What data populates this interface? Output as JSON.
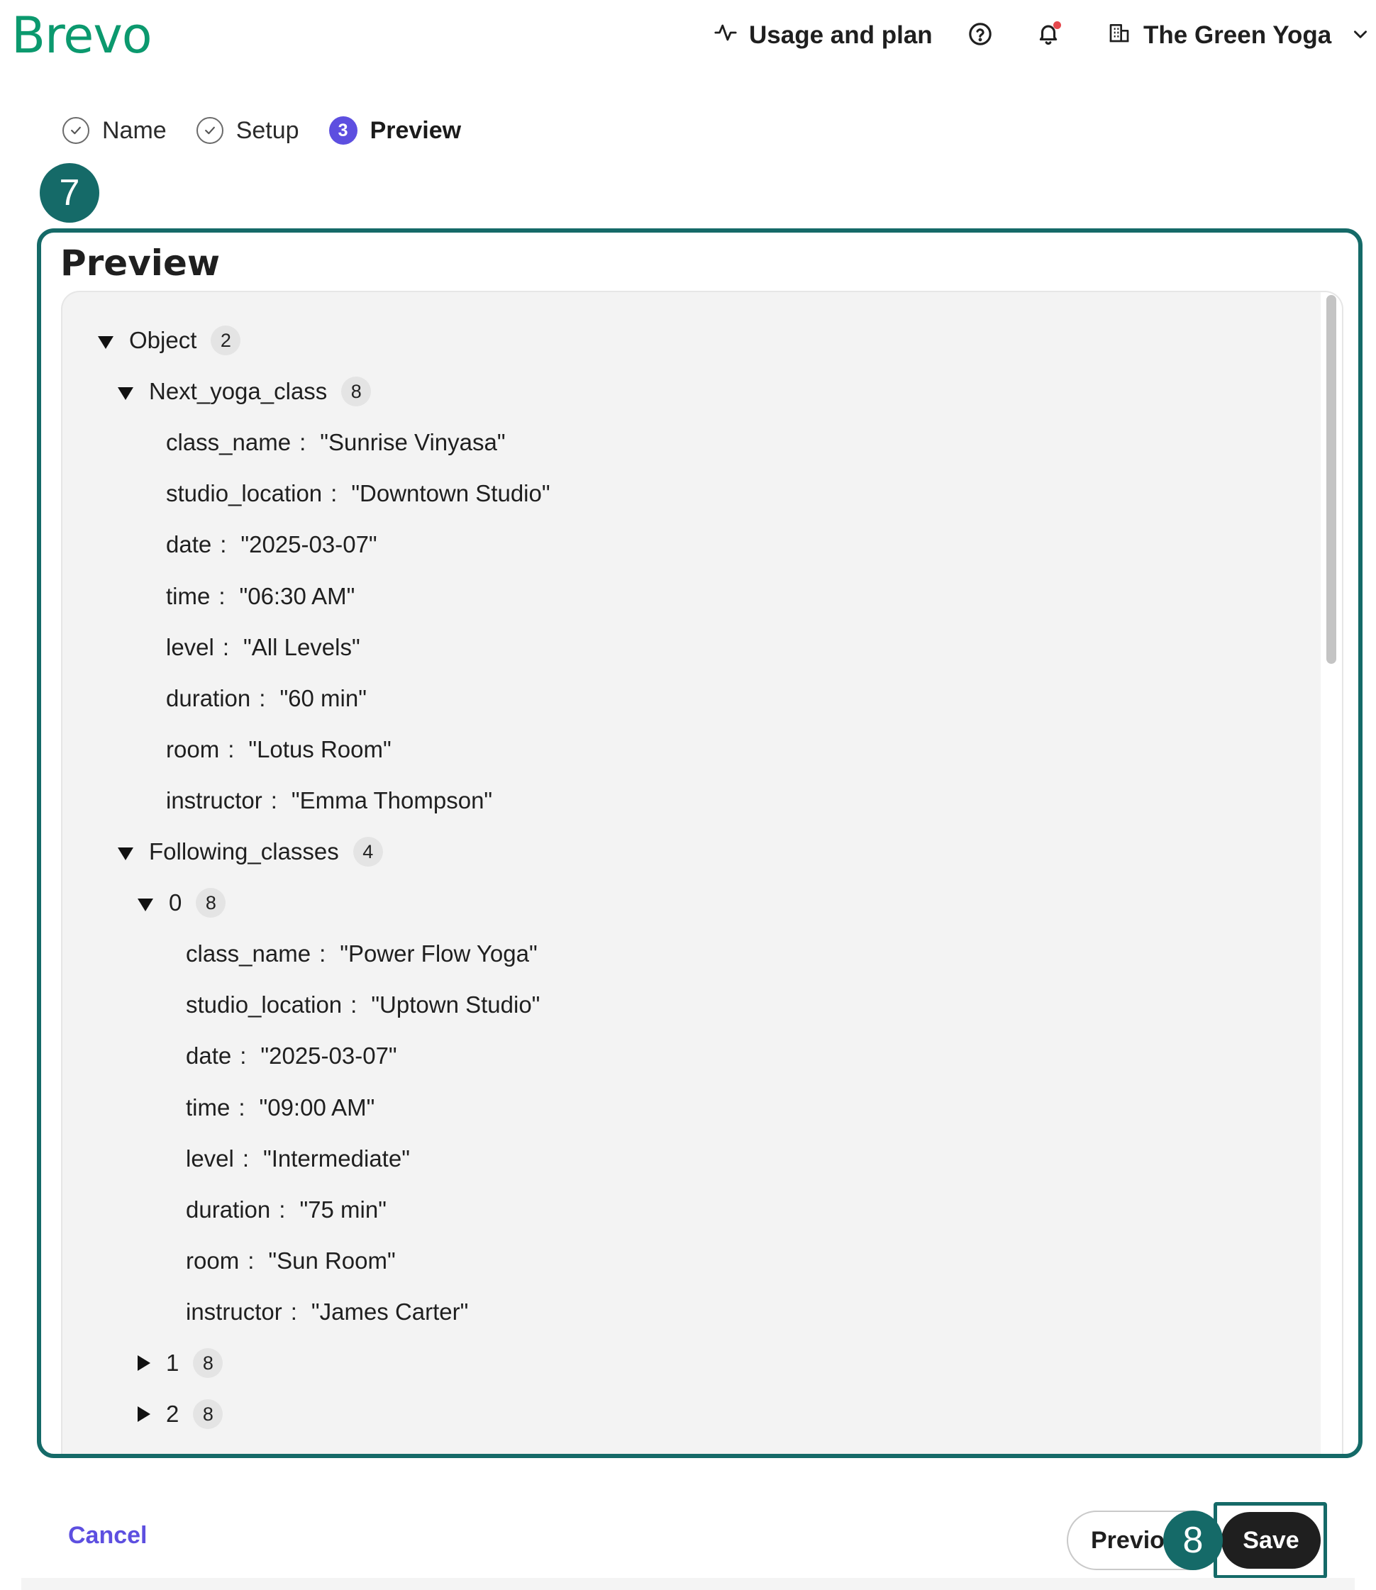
{
  "header": {
    "logo_text": "Brevo",
    "usage_label": "Usage and plan",
    "account_name": "The Green Yoga",
    "icons": [
      "activity-icon",
      "help-icon",
      "bell-icon",
      "building-icon",
      "chevron-down-icon"
    ]
  },
  "stepper": {
    "steps": [
      {
        "label": "Name",
        "state": "done"
      },
      {
        "label": "Setup",
        "state": "done"
      },
      {
        "label": "Preview",
        "number": "3",
        "state": "active"
      }
    ]
  },
  "annotations": {
    "marker_a": "7",
    "marker_b": "8"
  },
  "preview": {
    "title": "Preview",
    "tree": [
      {
        "depth": 0,
        "type": "node",
        "expanded": true,
        "label": "Object",
        "count": "2"
      },
      {
        "depth": 1,
        "type": "node",
        "expanded": true,
        "label": "Next_yoga_class",
        "count": "8"
      },
      {
        "depth": 2,
        "type": "leaf",
        "key": "class_name",
        "value": "\"Sunrise Vinyasa\""
      },
      {
        "depth": 2,
        "type": "leaf",
        "key": "studio_location",
        "value": "\"Downtown Studio\""
      },
      {
        "depth": 2,
        "type": "leaf",
        "key": "date",
        "value": "\"2025-03-07\""
      },
      {
        "depth": 2,
        "type": "leaf",
        "key": "time",
        "value": "\"06:30 AM\""
      },
      {
        "depth": 2,
        "type": "leaf",
        "key": "level",
        "value": "\"All Levels\""
      },
      {
        "depth": 2,
        "type": "leaf",
        "key": "duration",
        "value": "\"60 min\""
      },
      {
        "depth": 2,
        "type": "leaf",
        "key": "room",
        "value": "\"Lotus Room\""
      },
      {
        "depth": 2,
        "type": "leaf",
        "key": "instructor",
        "value": "\"Emma Thompson\""
      },
      {
        "depth": 1,
        "type": "node",
        "expanded": true,
        "label": "Following_classes",
        "count": "4"
      },
      {
        "depth": 2,
        "type": "node",
        "expanded": true,
        "label": "0",
        "count": "8"
      },
      {
        "depth": 3,
        "type": "leaf",
        "key": "class_name",
        "value": "\"Power Flow Yoga\""
      },
      {
        "depth": 3,
        "type": "leaf",
        "key": "studio_location",
        "value": "\"Uptown Studio\""
      },
      {
        "depth": 3,
        "type": "leaf",
        "key": "date",
        "value": "\"2025-03-07\""
      },
      {
        "depth": 3,
        "type": "leaf",
        "key": "time",
        "value": "\"09:00 AM\""
      },
      {
        "depth": 3,
        "type": "leaf",
        "key": "level",
        "value": "\"Intermediate\""
      },
      {
        "depth": 3,
        "type": "leaf",
        "key": "duration",
        "value": "\"75 min\""
      },
      {
        "depth": 3,
        "type": "leaf",
        "key": "room",
        "value": "\"Sun Room\""
      },
      {
        "depth": 3,
        "type": "leaf",
        "key": "instructor",
        "value": "\"James Carter\""
      },
      {
        "depth": 2,
        "type": "node",
        "expanded": false,
        "label": "1",
        "count": "8"
      },
      {
        "depth": 2,
        "type": "node",
        "expanded": false,
        "label": "2",
        "count": "8"
      }
    ]
  },
  "footer": {
    "cancel_label": "Cancel",
    "previous_label": "Previous",
    "save_label": "Save"
  },
  "colors": {
    "brand": "#0b996e",
    "accent": "#5d4fe0",
    "annotation": "#156a68",
    "notification_dot": "#e5484d"
  }
}
